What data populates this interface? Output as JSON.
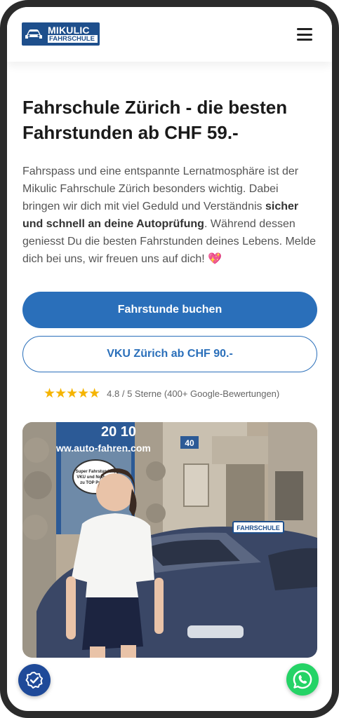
{
  "header": {
    "logo": {
      "line1": "MIKULIC",
      "line2": "FAHRSCHULE",
      "icon": "car-icon"
    },
    "menu_icon": "hamburger-menu-icon"
  },
  "hero": {
    "title": "Fahrschule Zürich - die besten Fahrstunden ab CHF 59.-",
    "intro_part1": "Fahrspass und eine entspannte Lernatmosphäre ist der Mikulic Fahrschule Zürich besonders wichtig. Dabei bringen wir dich mit viel Geduld und Verständnis ",
    "intro_bold": "sicher und schnell an deine Autoprüfung",
    "intro_part2": ". Während dessen geniesst Du die besten Fahrstunden deines Lebens. Melde dich bei uns, wir freuen uns auf dich! ",
    "intro_emoji": "💖"
  },
  "buttons": {
    "primary": "Fahrstunde buchen",
    "secondary": "VKU Zürich ab CHF 90.-"
  },
  "rating": {
    "stars": "★★★★★",
    "score": 4.8,
    "text": "4.8 / 5 Sterne (400+ Google-Bewertungen)"
  },
  "photo": {
    "alt": "Fahrschülerin vor Fahrschulauto",
    "signs": {
      "phone_fragment": "20 10",
      "website": "ww.auto-fahren.com",
      "speech_bubble": "Super Fahrstunden, VKU und Nothelfer zu TOP Preisen",
      "roof_sign": "FAHRSCHULE",
      "house_number": "40"
    }
  },
  "floating": {
    "left_icon": "badge-check-icon",
    "right_icon": "whatsapp-icon"
  },
  "colors": {
    "brand_blue": "#2a6fba",
    "logo_blue": "#1e4f8c",
    "star_gold": "#f5b400",
    "whatsapp_green": "#25d366"
  }
}
